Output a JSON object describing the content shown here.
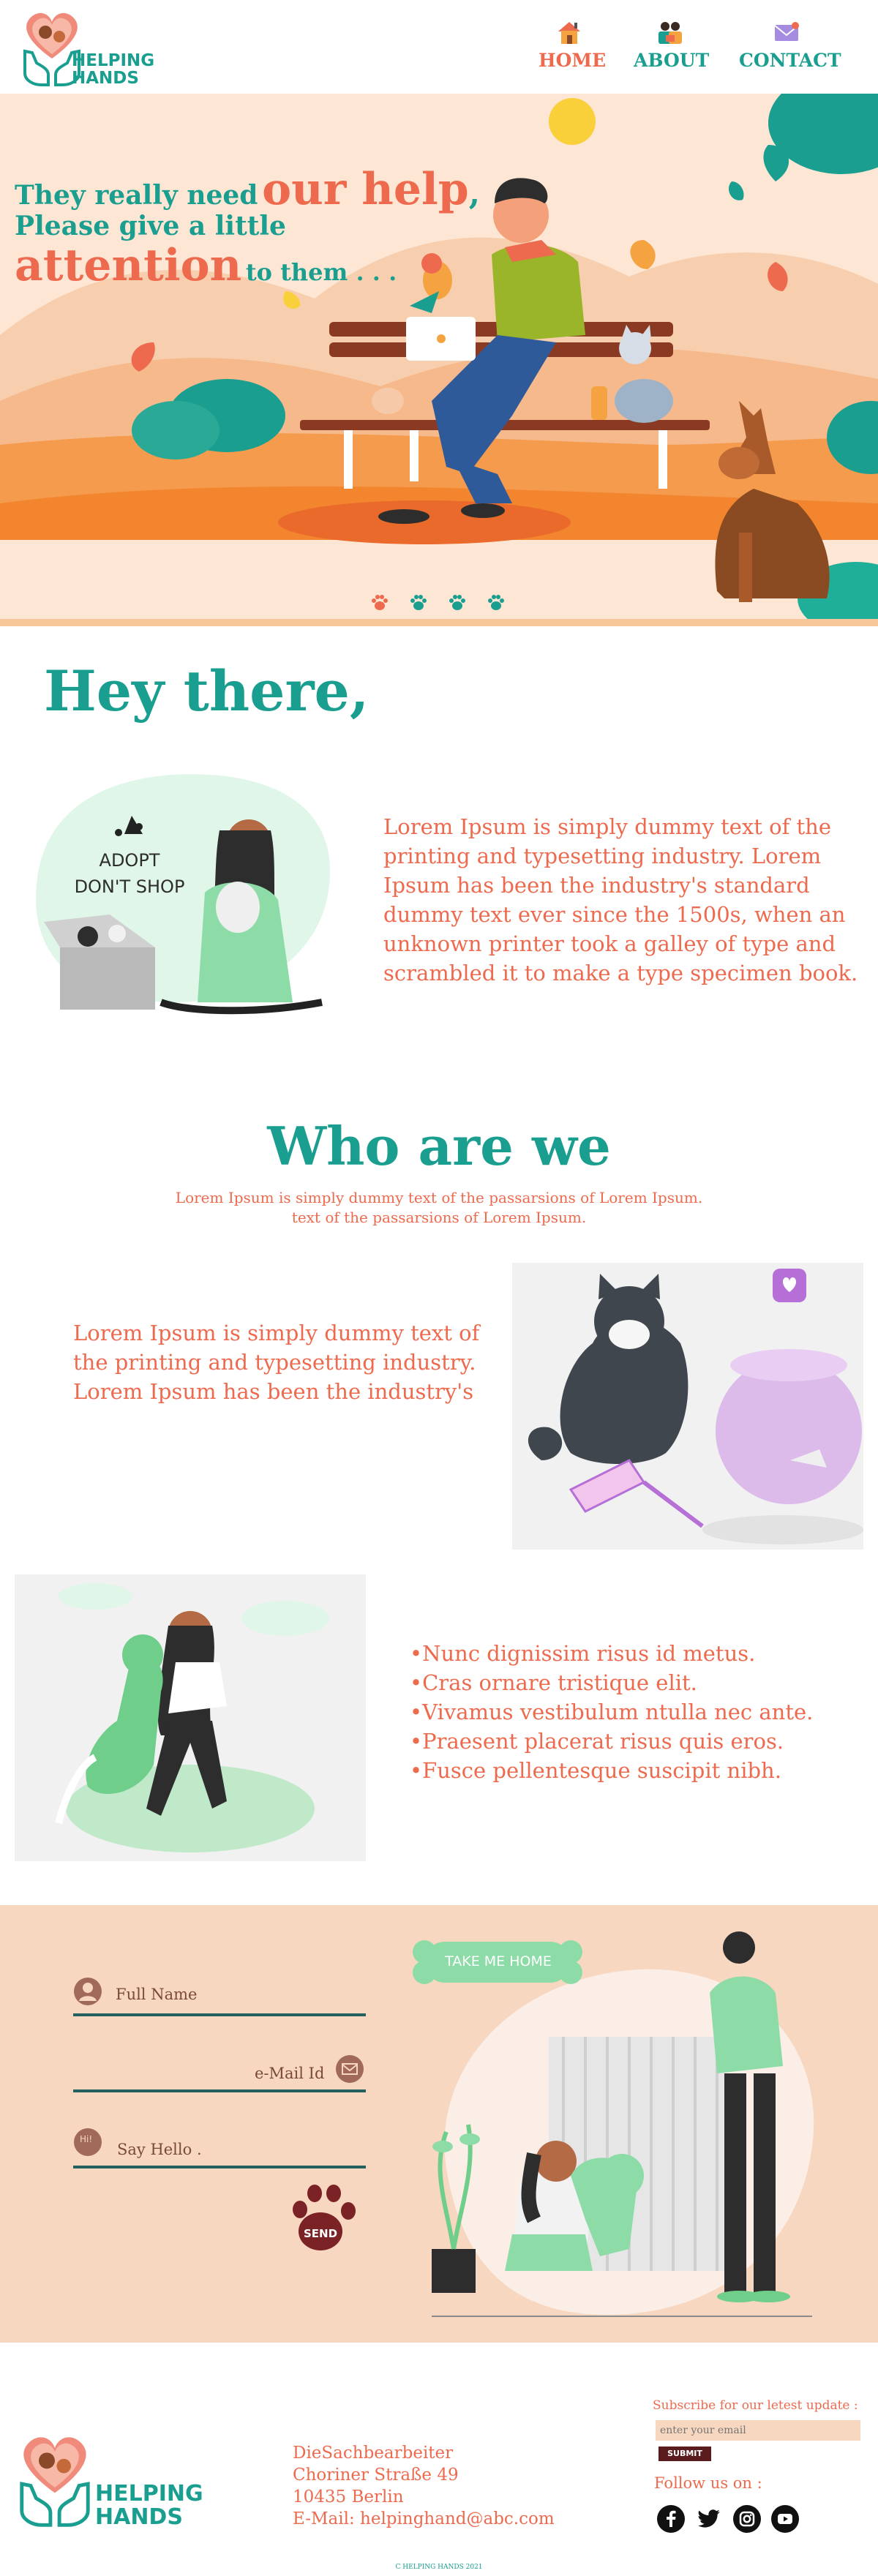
{
  "brand": {
    "line1": "HELPING",
    "line2": "HANDS"
  },
  "nav": [
    {
      "label": "HOME",
      "icon": "home-icon",
      "color": "#ee6a4e"
    },
    {
      "label": "ABOUT",
      "icon": "about-icon",
      "color": "#1a9e8f"
    },
    {
      "label": "CONTACT",
      "icon": "mail-icon",
      "color": "#1a9e8f"
    }
  ],
  "hero": {
    "line1_small": "They really need",
    "line1_big": "our help",
    "line1_comma": ",",
    "line2": "Please give a little",
    "line3_big": "attention",
    "line3_small": "to them . . ."
  },
  "greeting": {
    "title": "Hey there,",
    "paragraph": "Lorem Ipsum is simply dummy text of the printing and typesetting industry. Lorem Ipsum has been the industry's standard dummy text ever since the 1500s, when an unknown printer took a galley of type and scrambled it to make a type specimen book.",
    "sign_line1": "ADOPT",
    "sign_line2": "DON'T SHOP"
  },
  "who": {
    "title": "Who are we",
    "subtitle_line1": "Lorem Ipsum is simply dummy text of the passarsions of Lorem Ipsum.",
    "subtitle_line2": "text of the passarsions of Lorem Ipsum.",
    "paragraph": "Lorem Ipsum is simply dummy text of the printing and typesetting industry. Lorem Ipsum has been the industry's"
  },
  "bullets": [
    "•Nunc dignissim risus id metus.",
    "•Cras ornare tristique elit.",
    "•Vivamus vestibulum ntulla nec ante.",
    "•Praesent placerat risus quis eros.",
    "•Fusce pellentesque suscipit nibh."
  ],
  "form": {
    "name_label": "Full Name",
    "email_label": "e-Mail Id",
    "message_label": "Say Hello .",
    "message_badge": "Hi!",
    "send_label": "SEND",
    "sign_label": "TAKE ME HOME"
  },
  "footer": {
    "address": [
      "DieSachbearbeiter",
      "Choriner Straße 49",
      "10435 Berlin",
      "E-Mail: helpinghand@abc.com"
    ],
    "subscribe_title": "Subscribe for our letest update :",
    "email_placeholder": "enter your email",
    "submit_label": "SUBMIT",
    "follow_label": "Follow us on :",
    "social": [
      "facebook-icon",
      "twitter-icon",
      "instagram-icon",
      "youtube-icon"
    ],
    "copyright": "C  HELPING HANDS  2021"
  },
  "colors": {
    "teal": "#1a9e8f",
    "coral": "#ee6a4e",
    "peach": "#f8d7c0",
    "dark": "#24605f"
  }
}
